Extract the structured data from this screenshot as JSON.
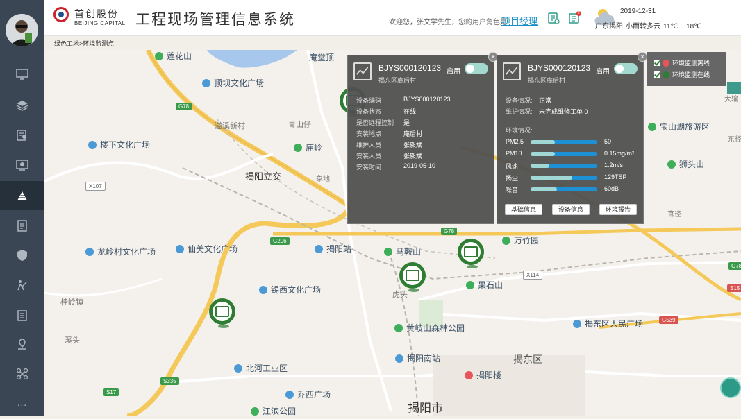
{
  "header": {
    "brand_cn": "首创股份",
    "brand_en": "BEIJING CAPITAL",
    "title": "工程现场管理信息系统",
    "welcome": "欢迎您，张文学先生，您的用户角色是",
    "role": "项目经理",
    "notification_badge": "2",
    "date": "2019-12-31",
    "location": "广东揭阳",
    "weather": "小雨转多云",
    "temperature": "11℃ ~ 18℃"
  },
  "breadcrumb": "绿色工地>环境监测点",
  "sidebar": {
    "items": [
      {
        "icon": "monitor-icon"
      },
      {
        "icon": "layers-icon"
      },
      {
        "icon": "document-person-icon"
      },
      {
        "icon": "camera-screen-icon"
      },
      {
        "icon": "construction-icon"
      },
      {
        "icon": "clipboard-icon"
      },
      {
        "icon": "shield-icon"
      },
      {
        "icon": "worker-icon"
      },
      {
        "icon": "list-icon"
      },
      {
        "icon": "location-icon"
      },
      {
        "icon": "drone-icon"
      },
      {
        "icon": "more-icon"
      }
    ],
    "more_label": "···"
  },
  "popup1": {
    "device_id": "BJYS000120123",
    "area": "揭东区庵后村",
    "toggle_label": "启用",
    "fields": [
      {
        "label": "设备编码",
        "value": "BJYS000120123"
      },
      {
        "label": "设备状态",
        "value": "在线"
      },
      {
        "label": "是否远程控制",
        "value": "是"
      },
      {
        "label": "安装地点",
        "value": "庵后村"
      },
      {
        "label": "维护人员",
        "value": "张毅斌"
      },
      {
        "label": "安装人员",
        "value": "张毅斌"
      },
      {
        "label": "安装时间",
        "value": "2019-05-10"
      }
    ]
  },
  "popup2": {
    "device_id": "BJYS000120123",
    "area": "揭东区庵后村",
    "toggle_label": "启用",
    "status_label": "设备情况:",
    "status_value": "正常",
    "maint_label": "维护情况:",
    "maint_value": "未完成维修工单 0",
    "env_label": "环境情况:",
    "metrics": [
      {
        "name": "PM2.5",
        "value": "50",
        "level": 0.36
      },
      {
        "name": "PM10",
        "value": "0.15mg/m³",
        "level": 0.36
      },
      {
        "name": "风速",
        "value": "1.2m/s",
        "level": 0.28
      },
      {
        "name": "扬尘",
        "value": "129TSP",
        "level": 0.62
      },
      {
        "name": "噪音",
        "value": "60dB",
        "level": 0.4
      }
    ],
    "buttons": [
      "基础信息",
      "设备信息",
      "环境报告"
    ]
  },
  "legend": {
    "items": [
      {
        "label": "环境监测离线",
        "color": "#e9545a"
      },
      {
        "label": "环境监测在线",
        "color": "#2e7d32"
      }
    ]
  },
  "map": {
    "places": [
      {
        "name": "莲花山",
        "type": "g"
      },
      {
        "name": "庵堂顶",
        "type": "none"
      },
      {
        "name": "顶坝文化广场",
        "type": "b"
      },
      {
        "name": "溢溪新村",
        "type": "none"
      },
      {
        "name": "青山仔",
        "type": "none"
      },
      {
        "name": "楼下文化广场",
        "type": "b"
      },
      {
        "name": "庙岭",
        "type": "g"
      },
      {
        "name": "揭阳立交",
        "type": "none"
      },
      {
        "name": "象地",
        "type": "none"
      },
      {
        "name": "龙岭村文化广场",
        "type": "b"
      },
      {
        "name": "仙美文化广场",
        "type": "b"
      },
      {
        "name": "揭阳站",
        "type": "b"
      },
      {
        "name": "马鞍山",
        "type": "g"
      },
      {
        "name": "万竹园",
        "type": "g"
      },
      {
        "name": "锡西文化广场",
        "type": "b"
      },
      {
        "name": "果石山",
        "type": "g"
      },
      {
        "name": "桂岭镇",
        "type": "none"
      },
      {
        "name": "虎头",
        "type": "none"
      },
      {
        "name": "黄岐山森林公园",
        "type": "g"
      },
      {
        "name": "揭东区人民广场",
        "type": "b"
      },
      {
        "name": "溪头",
        "type": "none"
      },
      {
        "name": "北河工业区",
        "type": "b"
      },
      {
        "name": "揭阳南站",
        "type": "b"
      },
      {
        "name": "揭东区",
        "type": "none"
      },
      {
        "name": "揭阳楼",
        "type": "g"
      },
      {
        "name": "乔西广场",
        "type": "b"
      },
      {
        "name": "揭阳市",
        "type": "none"
      },
      {
        "name": "宝山湖旅游区",
        "type": "g"
      },
      {
        "name": "东径",
        "type": "none"
      },
      {
        "name": "狮头山",
        "type": "g"
      },
      {
        "name": "官径",
        "type": "none"
      },
      {
        "name": "大输",
        "type": "none"
      },
      {
        "name": "江滨公园",
        "type": "g"
      }
    ],
    "roads": [
      "G78",
      "X107",
      "G206",
      "G78",
      "X114",
      "S335",
      "S17",
      "G539",
      "G78",
      "S15",
      "G78",
      "S15"
    ]
  }
}
